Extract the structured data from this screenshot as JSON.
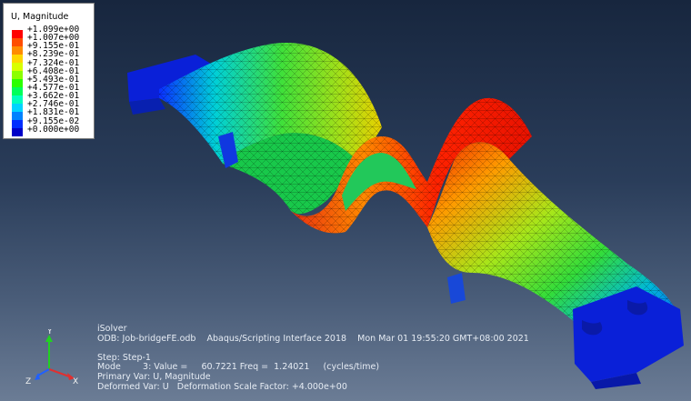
{
  "viewport": {
    "legend": {
      "title": "U, Magnitude",
      "labels": [
        "+1.099e+00",
        "+1.007e+00",
        "+9.155e-01",
        "+8.239e-01",
        "+7.324e-01",
        "+6.408e-01",
        "+5.493e-01",
        "+4.577e-01",
        "+3.662e-01",
        "+2.746e-01",
        "+1.831e-01",
        "+9.155e-02",
        "+0.000e+00"
      ],
      "colors": [
        "#ff0000",
        "#ff4d00",
        "#ff8c00",
        "#ffd700",
        "#d9ff00",
        "#8cff00",
        "#2cff00",
        "#00ff5a",
        "#00ffbe",
        "#00d4ff",
        "#0082ff",
        "#002dff",
        "#0000c8"
      ]
    },
    "info_lines": [
      "iSolver",
      "ODB: Job-bridgeFE.odb    Abaqus/Scripting Interface 2018    Mon Mar 01 19:55:20 GMT+08:00 2021",
      "",
      "Step: Step-1",
      "Mode        3: Value =     60.7221 Freq =  1.24021     (cycles/time)",
      "Primary Var: U, Magnitude",
      "Deformed Var: U   Deformation Scale Factor: +4.000e+00"
    ],
    "triad": {
      "x": "X",
      "y": "Y",
      "z": "Z"
    }
  }
}
